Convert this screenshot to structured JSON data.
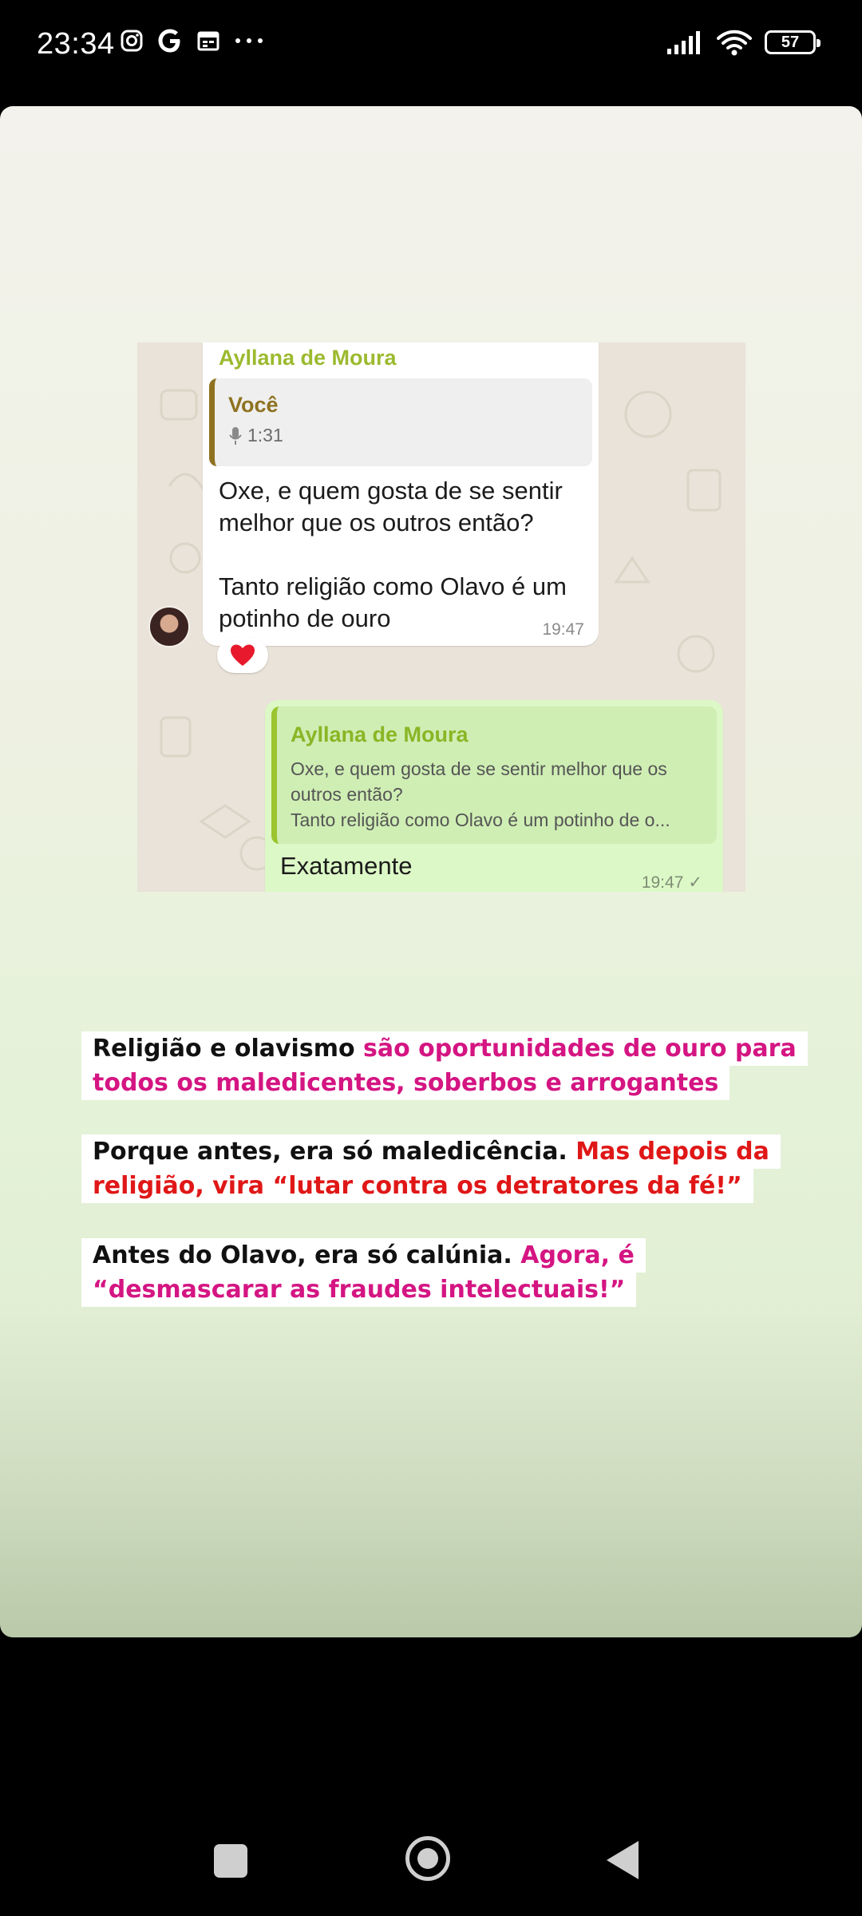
{
  "status_bar": {
    "time": "23:34",
    "left_icons": [
      "instagram-icon",
      "google-icon",
      "calendar-icon",
      "more-dots-icon"
    ],
    "right_icons": [
      "signal-icon",
      "wifi-icon",
      "battery-icon"
    ],
    "battery_percent": "57"
  },
  "chat": {
    "incoming": {
      "sender": "Ayllana de Moura",
      "quoted_name": "Você",
      "quoted_audio_duration": "1:31",
      "text": "Oxe, e quem gosta de se sentir melhor que os outros então?\n\nTanto religião como Olavo é um potinho de ouro",
      "time": "19:47",
      "reaction": "❤️"
    },
    "outgoing": {
      "quoted_name": "Ayllana de Moura",
      "quoted_text": "Oxe, e quem gosta de se sentir melhor que os outros então?\nTanto religião como Olavo é um potinho de o...",
      "text": "Exatamente",
      "time": "19:47",
      "status": "✓"
    }
  },
  "captions": [
    {
      "line1_black": "Religião e olavismo ",
      "line1_color": "são oportunidades de ouro para",
      "line2_color": "todos os maledicentes, soberbos e arrogantes"
    },
    {
      "line1_black": "Porque antes, era só maledicência. ",
      "line1_color": "Mas depois da",
      "line2_color": "religião, vira “lutar contra os detratores da fé!”"
    },
    {
      "line1_black": "Antes do Olavo, era só calúnia. ",
      "line1_color": "Agora, é",
      "line2_color": "“desmascarar as fraudes intelectuais!”"
    }
  ],
  "nav": {
    "buttons": [
      "recents-button",
      "home-button",
      "back-button"
    ]
  }
}
